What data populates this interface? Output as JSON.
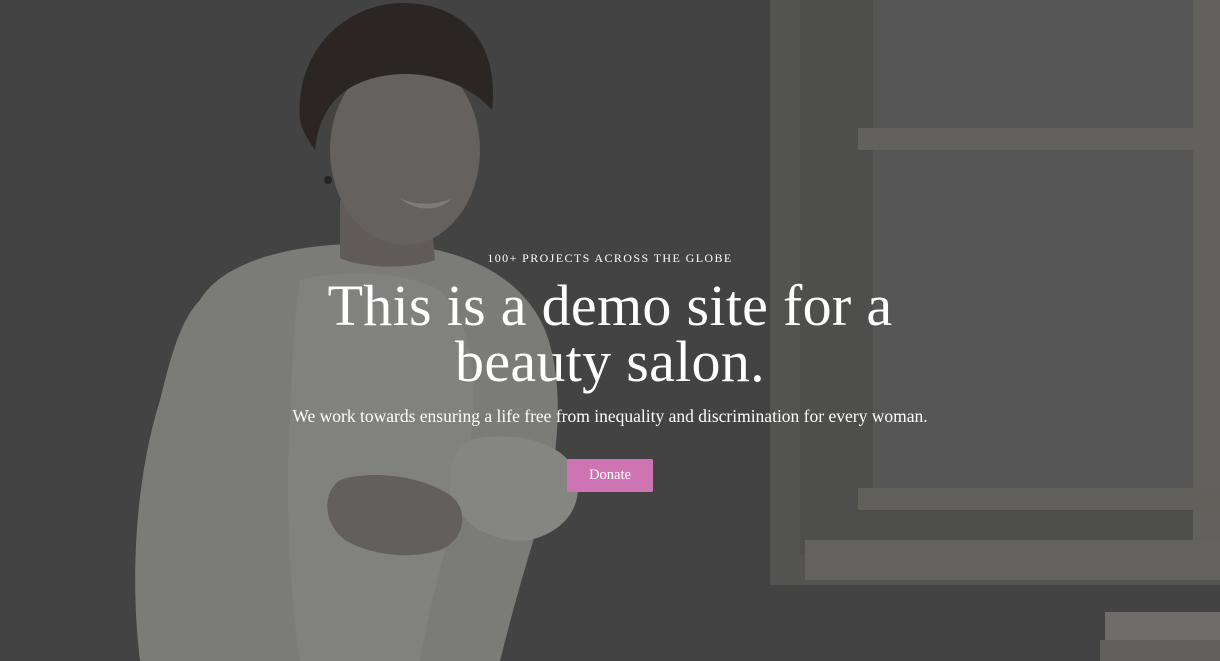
{
  "hero": {
    "eyebrow": "100+ PROJECTS ACROSS THE GLOBE",
    "headline": "This is a demo site for a beauty salon.",
    "subtitle": "We work towards ensuring a life free from inequality and discrimination for every woman.",
    "cta_label": "Donate"
  },
  "colors": {
    "cta_background": "#cf74b2",
    "text": "#ffffff",
    "overlay": "#3f3f3e"
  }
}
